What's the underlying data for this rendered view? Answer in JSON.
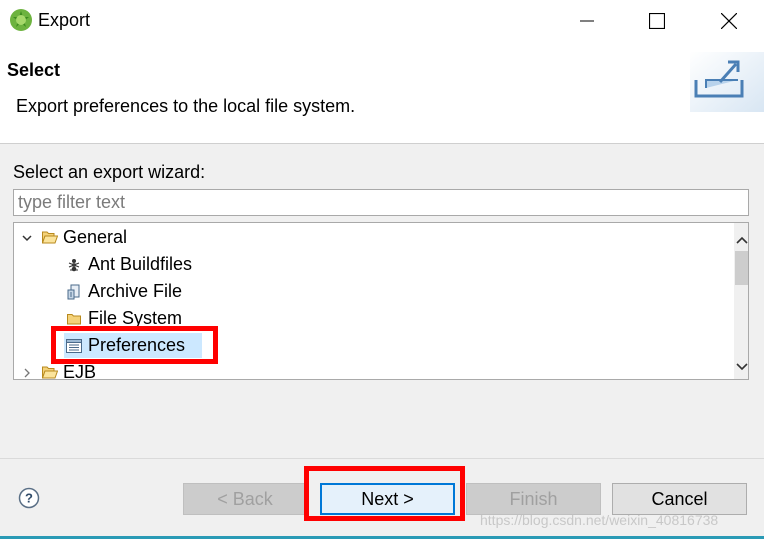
{
  "window": {
    "title": "Export",
    "controls": [
      "minimize",
      "maximize",
      "close"
    ]
  },
  "header": {
    "title": "Select",
    "description": "Export preferences to the local file system.",
    "image": "export-wizard-banner-icon"
  },
  "wizard": {
    "label": "Select an export wizard:",
    "filter_placeholder": "type filter text",
    "filter_value": ""
  },
  "tree": {
    "items": [
      {
        "label": "General",
        "icon": "folder-open-icon",
        "expanded": true,
        "level": 0
      },
      {
        "label": "Ant Buildfiles",
        "icon": "ant-icon",
        "level": 1
      },
      {
        "label": "Archive File",
        "icon": "archive-icon",
        "level": 1
      },
      {
        "label": "File System",
        "icon": "folder-icon",
        "level": 1
      },
      {
        "label": "Preferences",
        "icon": "preferences-icon",
        "level": 1,
        "selected": true
      },
      {
        "label": "EJB",
        "icon": "folder-open-icon",
        "expanded": false,
        "level": 0
      }
    ]
  },
  "buttons": {
    "back": "< Back",
    "next": "Next >",
    "finish": "Finish",
    "cancel": "Cancel"
  },
  "watermark": "https://blog.csdn.net/weixin_40816738",
  "colors": {
    "highlight": "#ff0000",
    "selection": "#cce8ff",
    "default_button_border": "#0078d7"
  }
}
